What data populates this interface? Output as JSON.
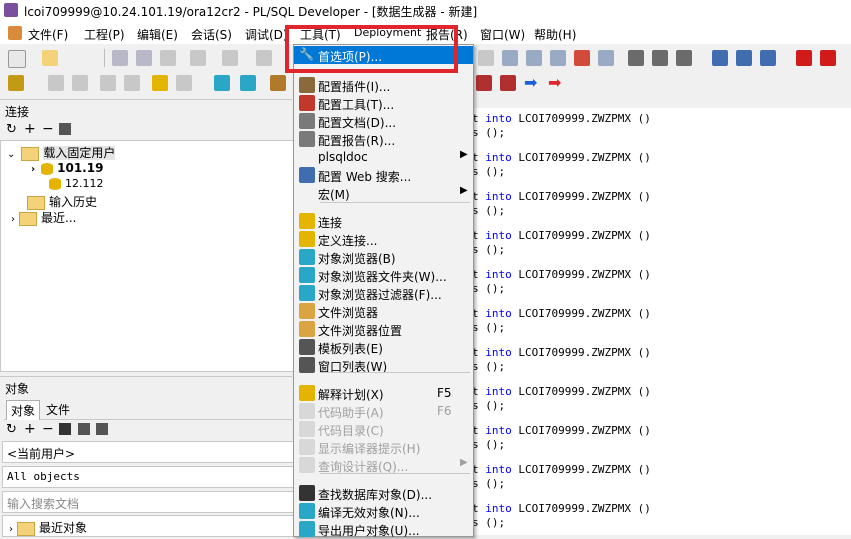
{
  "window": {
    "title": "lcoi709999@10.24.101.19/ora12cr2 - PL/SQL Developer - [数据生成器 - 新建]"
  },
  "menubar": [
    {
      "label": "文件(F)",
      "key": "file"
    },
    {
      "label": "工程(P)",
      "key": "project"
    },
    {
      "label": "编辑(E)",
      "key": "edit"
    },
    {
      "label": "会话(S)",
      "key": "session"
    },
    {
      "label": "调试(D)",
      "key": "debug"
    },
    {
      "label": "工具(T)",
      "key": "tools"
    },
    {
      "label": "Deployment",
      "key": "deployment"
    },
    {
      "label": "报告(R)",
      "key": "reports"
    },
    {
      "label": "窗口(W)",
      "key": "window"
    },
    {
      "label": "帮助(H)",
      "key": "help"
    }
  ],
  "left": {
    "connections_header": "连接",
    "tree": {
      "fixed_users": "载入固定用户",
      "conn1": "101.19",
      "conn2": "12.112",
      "history": "输入历史",
      "recent": "最近..."
    },
    "objects_header": "对象",
    "tabs": {
      "objects": "对象",
      "files": "文件"
    },
    "current_user": "<当前用户>",
    "filter": "All objects",
    "search_placeholder": "输入搜索文档",
    "recent_objects": "最近对象"
  },
  "code": {
    "lines": [
      {
        "prefix": "t ",
        "kw": "into",
        "text": " LCOI709999.ZWZPMX ()"
      },
      {
        "prefix": "s ",
        "kw": "",
        "text": "();"
      }
    ],
    "repeat": 11
  },
  "tools_menu": {
    "items": [
      {
        "label": "首选项(P)...",
        "state": "highlighted",
        "icon": "wrench-icon"
      },
      {
        "label": "配置插件(I)...",
        "icon": "plugin-icon"
      },
      {
        "label": "配置工具(T)...",
        "icon": "tool-config-icon"
      },
      {
        "label": "配置文档(D)...",
        "icon": "document-config-icon"
      },
      {
        "label": "配置报告(R)...",
        "icon": "report-config-icon"
      },
      {
        "label": "plsqldoc",
        "submenu": true
      },
      {
        "label": "配置 Web 搜索...",
        "icon": "web-search-icon"
      },
      {
        "label": "宏(M)",
        "submenu": true
      },
      {
        "label": "连接",
        "icon": "database-icon"
      },
      {
        "label": "定义连接...",
        "icon": "database-config-icon"
      },
      {
        "label": "对象浏览器(B)",
        "icon": "object-browser-icon"
      },
      {
        "label": "对象浏览器文件夹(W)...",
        "icon": "object-folder-icon"
      },
      {
        "label": "对象浏览器过滤器(F)...",
        "icon": "object-filter-icon"
      },
      {
        "label": "文件浏览器",
        "icon": "file-browser-icon"
      },
      {
        "label": "文件浏览器位置",
        "icon": "file-location-icon"
      },
      {
        "label": "模板列表(E)",
        "icon": "template-list-icon"
      },
      {
        "label": "窗口列表(W)",
        "icon": "window-list-icon"
      },
      {
        "label": "解释计划(X)",
        "shortcut": "F5",
        "icon": "explain-plan-icon"
      },
      {
        "label": "代码助手(A)",
        "shortcut": "F6",
        "disabled": true,
        "icon": "code-assistant-icon"
      },
      {
        "label": "代码目录(C)",
        "disabled": true,
        "icon": "code-contents-icon"
      },
      {
        "label": "显示编译器提示(H)",
        "disabled": true,
        "icon": "compiler-hint-icon"
      },
      {
        "label": "查询设计器(Q)...",
        "disabled": true,
        "submenu": true,
        "icon": "query-designer-icon"
      },
      {
        "label": "查找数据库对象(D)...",
        "icon": "find-db-object-icon"
      },
      {
        "label": "编译无效对象(N)...",
        "icon": "compile-invalid-icon"
      },
      {
        "label": "导出用户对象(U)...",
        "icon": "export-user-object-icon"
      }
    ]
  },
  "colors": {
    "highlight": "#0078d7",
    "annotation_box": "#e0262c",
    "keyword": "#0000ff"
  }
}
